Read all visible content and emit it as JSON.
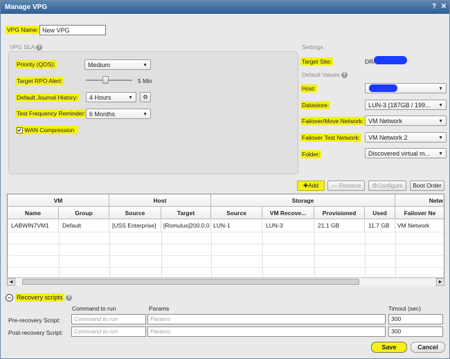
{
  "window": {
    "title": "Manage VPG",
    "help_glyph": "?",
    "close_glyph": "✕"
  },
  "vpg_name": {
    "label": "VPG Name:",
    "value": "New VPG"
  },
  "sla": {
    "title": "VPG SLA",
    "priority": {
      "label": "Priority (QOS):",
      "value": "Medium"
    },
    "rpo": {
      "label": "Target RPO Alert:",
      "value": "5 Min"
    },
    "journal": {
      "label": "Default Journal History:",
      "value": "4 Hours"
    },
    "test_freq": {
      "label": "Test Frequency Reminder:",
      "value": "6 Months"
    },
    "wan": {
      "label": "WAN Compression",
      "checked": true
    }
  },
  "settings": {
    "title": "Settings",
    "target_site": {
      "label": "Target Site:",
      "value": "DR/"
    },
    "defaults_title": "Default Values",
    "host": {
      "label": "Host:",
      "value": ""
    },
    "datastore": {
      "label": "Datastore:",
      "value": "LUN-3 (187GB / 199..."
    },
    "failover_net": {
      "label": "Failover/Move Network:",
      "value": "VM Network"
    },
    "failover_test_net": {
      "label": "Failover Test Network:",
      "value": "VM Network 2"
    },
    "folder": {
      "label": "Folder:",
      "value": "Discovered virtual m..."
    }
  },
  "actions": {
    "add": "Add",
    "remove": "Remove",
    "configure": "Configure",
    "boot_order": "Boot Order"
  },
  "grid": {
    "groups": [
      "VM",
      "Host",
      "Storage",
      "Netw"
    ],
    "columns": [
      "Name",
      "Group",
      "Source",
      "Target",
      "Source",
      "VM Recove...",
      "Provisioned",
      "Used",
      "Failover Ne"
    ],
    "rows": [
      [
        "LABWIN7VM1",
        "Default",
        "[USS Enterprise]",
        "[Romulus]200.0.0",
        "LUN-1",
        "LUN-3",
        "21.1 GB",
        "11.7 GB",
        "VM Network"
      ]
    ]
  },
  "recovery": {
    "title": "Recovery scripts",
    "col_command": "Command to run",
    "col_params": "Params",
    "col_timeout": "Timout (sec)",
    "pre": {
      "label": "Pre-recovery Script:",
      "command_placeholder": "Command to run",
      "params_placeholder": "Params",
      "timeout": "300"
    },
    "post": {
      "label": "Post-recovery Script:",
      "command_placeholder": "Command to run",
      "params_placeholder": "Params",
      "timeout": "300"
    }
  },
  "footer": {
    "save": "Save",
    "cancel": "Cancel"
  },
  "colors": {
    "highlight": "#f4f018",
    "titlebar": "#3d6a9c",
    "redaction": "#1a3cff"
  }
}
